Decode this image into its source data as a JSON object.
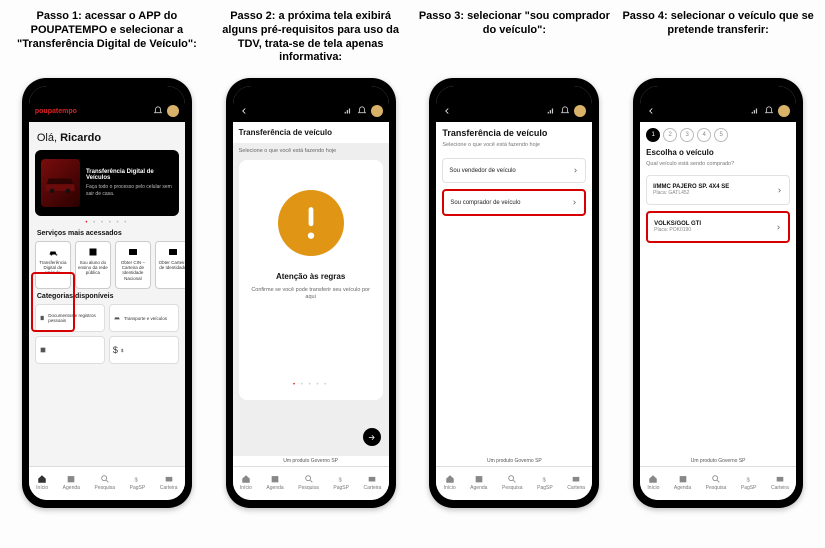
{
  "steps": [
    {
      "title": "Passo 1: acessar o APP do POUPATEMPO e selecionar a \"Transferência Digital de Veículo\":"
    },
    {
      "title": "Passo 2: a próxima tela exibirá alguns pré-requisitos para uso da TDV, trata-se de tela apenas informativa:"
    },
    {
      "title": "Passo 3: selecionar \"sou comprador do veículo\":"
    },
    {
      "title": "Passo 4: selecionar o veículo que se pretende transferir:"
    }
  ],
  "nav": {
    "home": "Início",
    "agenda": "Agenda",
    "search": "Pesquisa",
    "pay": "PagSP",
    "wallet": "Carteira"
  },
  "header": {
    "brand": "poupatempo"
  },
  "s1": {
    "greeting_prefix": "Olá, ",
    "greeting_name": "Ricardo",
    "hero_title": "Transferência Digital de Veículos",
    "hero_sub": "Faça todo o processo pelo celular sem sair de casa.",
    "section1": "Serviços mais acessados",
    "section2": "Categorias disponíveis",
    "tiles": [
      "Transferência Digital de Veículo",
      "Sou aluno do ensino da rede pública",
      "Obter CIN – Carteira de Identidade Nacional",
      "Obter Carteira de Identidade"
    ],
    "cats": [
      "Documentos e registros pessoais",
      "Transporte e veículos",
      "",
      "$"
    ]
  },
  "s2": {
    "title": "Transferência de veículo",
    "sub": "Selecione o que você está fazendo hoje",
    "modal_title": "Atenção às regras",
    "modal_body": "Confirme se você pode transferir seu veículo por aqui",
    "footer": "Um produto   Governo SP"
  },
  "s3": {
    "title": "Transferência de veículo",
    "sub": "Selecione o que você está fazendo hoje",
    "opt1": "Sou vendedor de veículo",
    "opt2": "Sou comprador de veículo",
    "footer": "Um produto   Governo SP"
  },
  "s4": {
    "stepper": [
      "1",
      "2",
      "3",
      "4",
      "5"
    ],
    "heading": "Escolha o veículo",
    "sub": "Qual veículo está sendo comprado?",
    "veh1_name": "I/MMC PAJERO SP. 4X4 SE",
    "veh1_plate": "Placa: GATL452",
    "veh2_name": "VOLKS/GOL GTI",
    "veh2_plate": "Placa: POK0190",
    "footer": "Um produto   Governo SP"
  }
}
